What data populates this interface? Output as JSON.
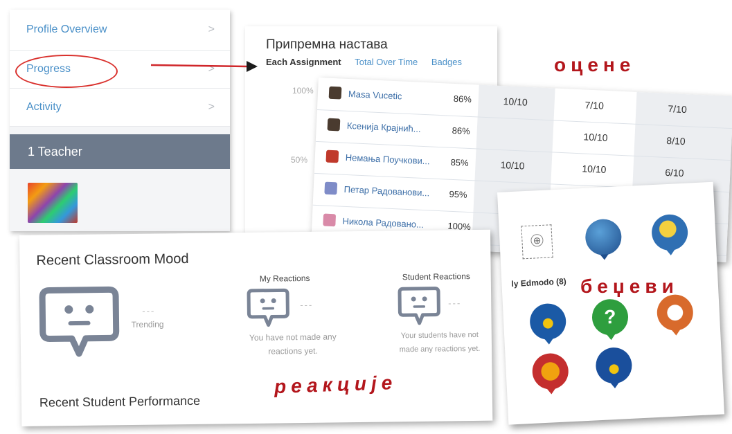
{
  "sidebar": {
    "items": [
      {
        "label": "Profile Overview"
      },
      {
        "label": "Progress"
      },
      {
        "label": "Activity"
      }
    ],
    "teacher_label": "1 Teacher"
  },
  "progress_panel": {
    "title": "Припремна настава",
    "tabs": {
      "active": "Each Assignment",
      "total": "Total Over Time",
      "badges": "Badges"
    },
    "yticks": [
      "100%",
      "50%"
    ]
  },
  "annotations": {
    "grades": "оцене",
    "badges": "беџеви",
    "reactions": "реакције"
  },
  "grades": {
    "students": [
      {
        "name": "Masa Vucetic",
        "percent": "86%",
        "icon_color": "#4a3b2f"
      },
      {
        "name": "Ксенија Крајнић...",
        "percent": "86%",
        "icon_color": "#4a3b2f"
      },
      {
        "name": "Немања Поучкови...",
        "percent": "85%",
        "icon_color": "#c0392b"
      },
      {
        "name": "Петар Радованови...",
        "percent": "95%",
        "icon_color": "#7f8cc8"
      },
      {
        "name": "Никола Радовано...",
        "percent": "100%",
        "icon_color": "#d98aa8"
      }
    ],
    "col1": [
      "10/10",
      "",
      "10/10"
    ],
    "col2": [
      "7/10",
      "10/10",
      "10/10"
    ],
    "col3": [
      "7/10",
      "8/10",
      "6/10"
    ]
  },
  "badges": {
    "label": "ly Edmodo (8)",
    "add_symbol": "⊕",
    "items": [
      {
        "icon": "p-logo-badge",
        "color": "#1f4e8c"
      },
      {
        "icon": "bee-badge",
        "color": "#2f6fb3"
      },
      {
        "icon": "medal-badge",
        "color": "#1b5aa6"
      },
      {
        "icon": "question-badge",
        "color": "#2e9e3e"
      },
      {
        "icon": "checkmark-badge",
        "color": "#d86a2c"
      },
      {
        "icon": "star-badge",
        "color": "#c42e2e"
      },
      {
        "icon": "ribbon-medal-badge",
        "color": "#1a4f9c"
      }
    ]
  },
  "mood": {
    "title": "Recent Classroom Mood",
    "trending": "Trending",
    "dashes": "---",
    "my_reactions": "My Reactions",
    "my_note_1": "You have not made any",
    "my_note_2": "reactions yet.",
    "student_reactions": "Student Reactions",
    "student_note_1": "Your students have not",
    "student_note_2": "made any reactions yet.",
    "performance_title": "Recent Student Performance"
  }
}
